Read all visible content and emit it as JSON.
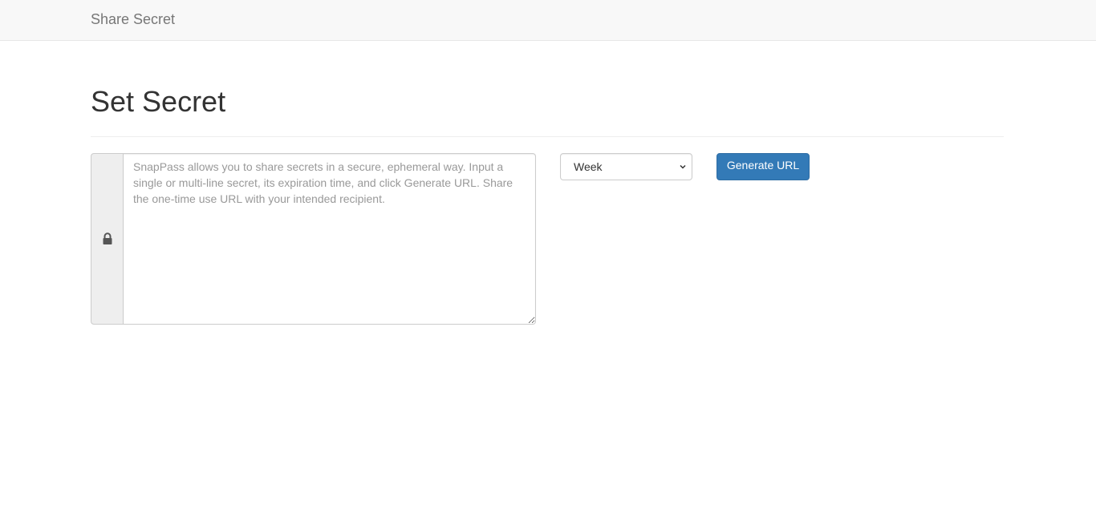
{
  "navbar": {
    "brand": "Share Secret"
  },
  "page": {
    "title": "Set Secret"
  },
  "form": {
    "secret": {
      "value": "",
      "placeholder": "SnapPass allows you to share secrets in a secure, ephemeral way. Input a single or multi-line secret, its expiration time, and click Generate URL. Share the one-time use URL with your intended recipient.",
      "addon_icon": "lock-icon"
    },
    "ttl": {
      "selected": "Week"
    },
    "submit_label": "Generate URL"
  },
  "colors": {
    "navbar_bg": "#f8f8f8",
    "primary_button": "#337ab7",
    "addon_bg": "#eeeeee"
  }
}
